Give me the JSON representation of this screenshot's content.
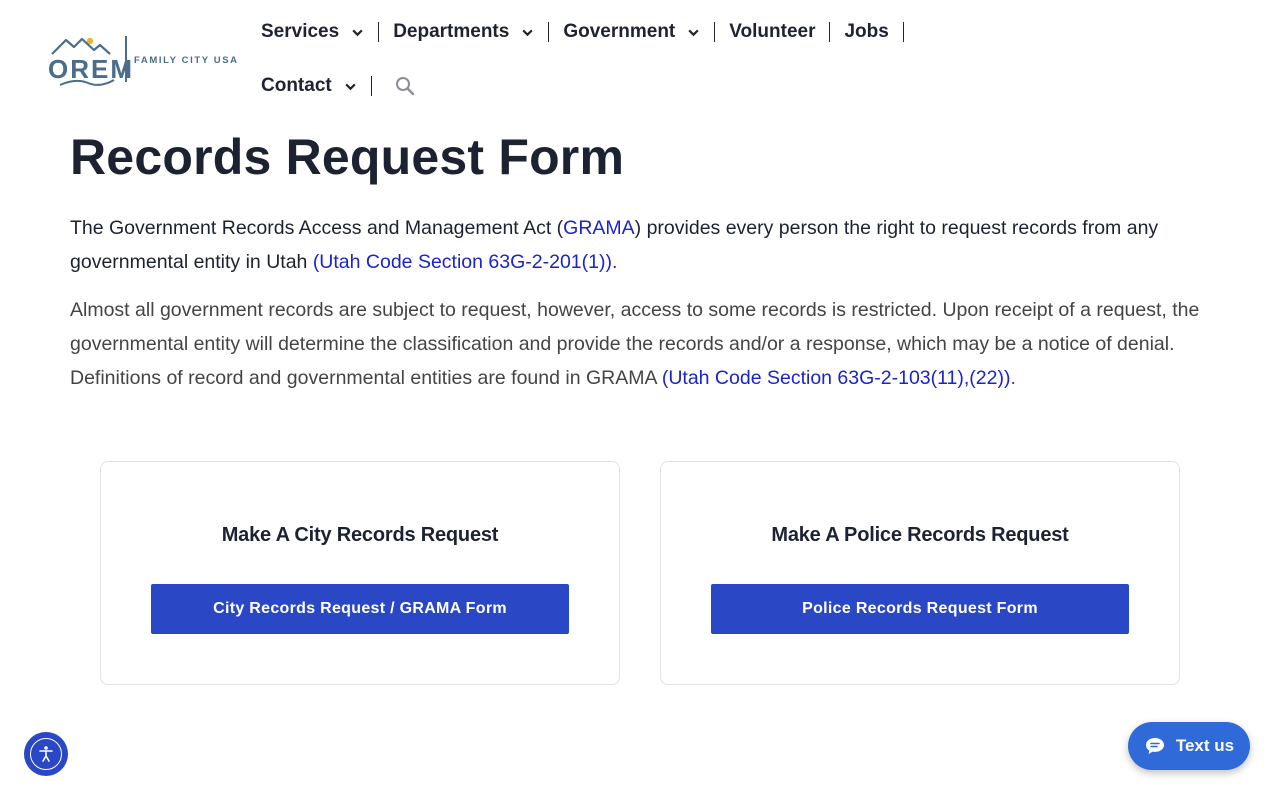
{
  "logo": {
    "wordmark": "OREM",
    "tagline": "FAMILY CITY USA",
    "colors": {
      "primary": "#4a6d8c",
      "sun": "#e9b82f"
    }
  },
  "nav": {
    "row1": [
      {
        "label": "Services",
        "dropdown": true
      },
      {
        "label": "Departments",
        "dropdown": true
      },
      {
        "label": "Government",
        "dropdown": true
      },
      {
        "label": "Volunteer",
        "dropdown": false
      },
      {
        "label": "Jobs",
        "dropdown": false
      }
    ],
    "row2": [
      {
        "label": "Contact",
        "dropdown": true
      }
    ],
    "search_icon": "search-icon"
  },
  "main": {
    "title": "Records Request Form",
    "para1": {
      "t1": "The Government Records Access and Management Act (",
      "link1": "GRAMA",
      "t2": ") provides every person the right to request records from any governmental entity in Utah ",
      "link2": "(Utah Code Section 63G-2-201(1))."
    },
    "para2": {
      "t1": "Almost all government records are subject to request, however, access to some records is restricted. Upon receipt of a request, the governmental entity will determine the classification and provide the records and/or a response, which may be a notice of denial. Definitions of record and governmental entities are found in GRAMA ",
      "link1": "(Utah Code Section 63G-2-103(11),(22))",
      "t2": "."
    },
    "cards": [
      {
        "title": "Make A City Records Request",
        "button": "City Records Request / GRAMA Form"
      },
      {
        "title": "Make A Police Records Request",
        "button": "Police Records Request Form"
      }
    ]
  },
  "widgets": {
    "accessibility_icon": "accessibility-icon",
    "text_us_label": "Text us",
    "chat_icon": "chat-bubble-icon"
  },
  "colors": {
    "accent": "#2a47c5",
    "link": "#1a24c9",
    "heading": "#1d2232",
    "text_us": "#2f6ad8"
  }
}
